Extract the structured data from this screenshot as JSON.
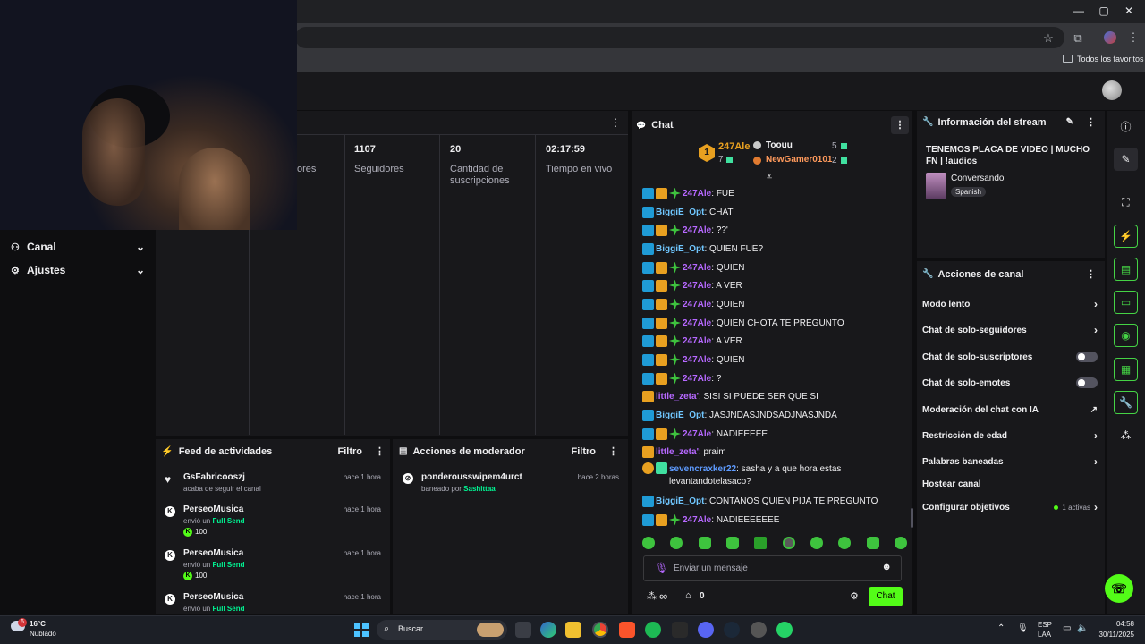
{
  "browser": {
    "bookmarks_folder": "Todos los favoritos",
    "window_controls": [
      "—",
      "▢",
      "✕"
    ]
  },
  "sidebar": {
    "items": [
      {
        "label": "Canal",
        "icon": "users-icon"
      },
      {
        "label": "Ajustes",
        "icon": "gear-icon"
      }
    ]
  },
  "stats": {
    "partial_label": "ores",
    "columns": [
      {
        "value": "1107",
        "label": "Seguidores"
      },
      {
        "value": "20",
        "label": "Cantidad de suscripciones"
      },
      {
        "value": "02:17:59",
        "label": "Tiempo en vivo"
      }
    ]
  },
  "feed": {
    "title": "Feed de actividades",
    "filter_label": "Filtro",
    "items": [
      {
        "user": "GsFabricooszj",
        "action": "acaba de seguir el canal",
        "time": "hace 1 hora",
        "icon": "heart-icon"
      },
      {
        "user": "PerseoMusica",
        "action": "envió un",
        "item": "Full Send",
        "amount": "100",
        "time": "hace 1 hora",
        "icon": "kick-icon"
      },
      {
        "user": "PerseoMusica",
        "action": "envió un",
        "item": "Full Send",
        "amount": "100",
        "time": "hace 1 hora",
        "icon": "kick-icon"
      },
      {
        "user": "PerseoMusica",
        "action": "envió un",
        "item": "Full Send",
        "time": "hace 1 hora",
        "icon": "kick-icon"
      }
    ]
  },
  "modactions": {
    "title": "Acciones de moderador",
    "filter_label": "Filtro",
    "items": [
      {
        "user": "ponderousswipem4urct",
        "action": "baneado por",
        "by": "Sashittaa",
        "time": "hace 2 horas"
      }
    ]
  },
  "chat": {
    "title": "Chat",
    "leaderboard": {
      "first": {
        "rank": "1",
        "user": "247Ale",
        "count": "7"
      },
      "second": {
        "user": "Toouu",
        "count": "5"
      },
      "third": {
        "user": "NewGamer0101",
        "count": "2"
      }
    },
    "messages": [
      {
        "user": "247Ale",
        "text": "FUE",
        "style": "purple",
        "badges": [
          "mod",
          "sub",
          "pr"
        ]
      },
      {
        "user": "BiggiE_Opt",
        "text": "CHAT",
        "style": "blue",
        "badges": [
          "mod"
        ]
      },
      {
        "user": "247Ale",
        "text": "??'",
        "style": "purple",
        "badges": [
          "mod",
          "sub",
          "pr"
        ]
      },
      {
        "user": "BiggiE_Opt",
        "text": "QUIEN FUE?",
        "style": "blue",
        "badges": [
          "mod"
        ]
      },
      {
        "user": "247Ale",
        "text": "QUIEN",
        "style": "purple",
        "badges": [
          "mod",
          "sub",
          "pr"
        ]
      },
      {
        "user": "247Ale",
        "text": "A VER",
        "style": "purple",
        "badges": [
          "mod",
          "sub",
          "pr"
        ]
      },
      {
        "user": "247Ale",
        "text": "QUIEN",
        "style": "purple",
        "badges": [
          "mod",
          "sub",
          "pr"
        ]
      },
      {
        "user": "247Ale",
        "text": "QUIEN CHOTA TE PREGUNTO",
        "style": "purple",
        "badges": [
          "mod",
          "sub",
          "pr"
        ]
      },
      {
        "user": "247Ale",
        "text": "A VER",
        "style": "purple",
        "badges": [
          "mod",
          "sub",
          "pr"
        ]
      },
      {
        "user": "247Ale",
        "text": "QUIEN",
        "style": "purple",
        "badges": [
          "mod",
          "sub",
          "pr"
        ]
      },
      {
        "user": "247Ale",
        "text": "?",
        "style": "purple",
        "badges": [
          "mod",
          "sub",
          "pr"
        ]
      },
      {
        "user": "little_zeta'",
        "text": "SISI SI PUEDE SER QUE SI",
        "style": "purple",
        "badges": [
          "sub"
        ]
      },
      {
        "user": "BiggiE_Opt",
        "text": "JASJNDASJNDSADJNASJNDA",
        "style": "blue",
        "badges": [
          "mod"
        ]
      },
      {
        "user": "247Ale",
        "text": "NADIEEEEE",
        "style": "purple",
        "badges": [
          "mod",
          "sub",
          "pr"
        ]
      },
      {
        "user": "little_zeta'",
        "text": "praim",
        "style": "purple",
        "badges": [
          "sub"
        ]
      },
      {
        "user": "sevencraxker22",
        "text": "sasha y a que hora estas levantandotelasaco?",
        "style": "blue2",
        "badges": [
          "one",
          "tv"
        ]
      },
      {
        "user": "BiggiE_Opt",
        "text": "CONTANOS QUIEN PIJA TE PREGUNTO",
        "style": "blue",
        "badges": [
          "mod"
        ]
      },
      {
        "user": "247Ale",
        "text": "NADIEEEEEEE",
        "style": "purple",
        "badges": [
          "mod",
          "sub",
          "pr"
        ]
      }
    ],
    "input_placeholder": "Enviar un mensaje",
    "points": "∞",
    "store_count": "0",
    "send_label": "Chat"
  },
  "stream_info": {
    "title": "Información del stream",
    "stream_title": "TENEMOS PLACA DE VIDEO | MUCHO FN | !audios",
    "category": "Conversando",
    "language": "Spanish"
  },
  "channel_actions": {
    "title": "Acciones de canal",
    "items": [
      {
        "label": "Modo lento",
        "control": "chevron"
      },
      {
        "label": "Chat de solo-seguidores",
        "control": "chevron"
      },
      {
        "label": "Chat de solo-suscriptores",
        "control": "toggle"
      },
      {
        "label": "Chat de solo-emotes",
        "control": "toggle"
      },
      {
        "label": "Moderación del chat con IA",
        "control": "external"
      },
      {
        "label": "Restricción de edad",
        "control": "chevron"
      },
      {
        "label": "Palabras baneadas",
        "control": "chevron"
      },
      {
        "label": "Hostear canal",
        "control": "none"
      },
      {
        "label": "Configurar objetivos",
        "control": "chevron",
        "badge": "1 activas"
      }
    ]
  },
  "taskbar": {
    "weather_temp": "16°C",
    "weather_desc": "Nublado",
    "weather_badge": "6",
    "search_label": "Buscar",
    "lang": "ESP",
    "region": "LAA",
    "time": "04:58",
    "date": "30/11/2025"
  },
  "colors": {
    "accent": "#53fc18",
    "bg": "#0e0e10",
    "panel": "#18181b"
  }
}
